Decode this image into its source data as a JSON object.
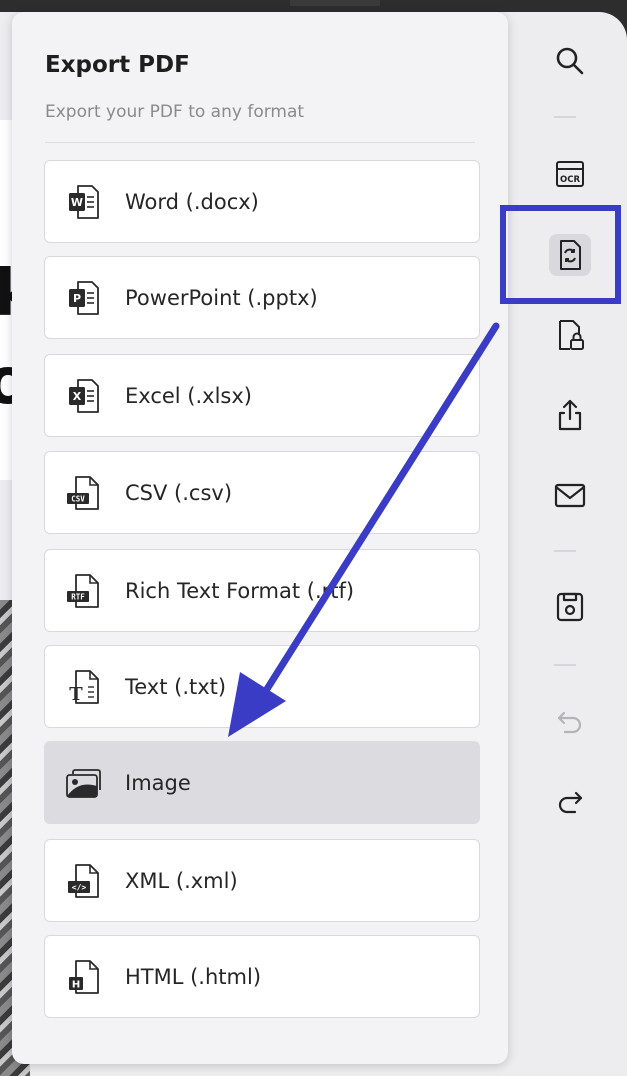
{
  "panel": {
    "title": "Export PDF",
    "subtitle": "Export your PDF to any format",
    "selected_index": 6
  },
  "formats": [
    {
      "label": "Word (.docx)",
      "icon": "word-file-icon",
      "glyph": "W"
    },
    {
      "label": "PowerPoint (.pptx)",
      "icon": "powerpoint-file-icon",
      "glyph": "P"
    },
    {
      "label": "Excel (.xlsx)",
      "icon": "excel-file-icon",
      "glyph": "X"
    },
    {
      "label": "CSV (.csv)",
      "icon": "csv-file-icon",
      "glyph": "CSV"
    },
    {
      "label": "Rich Text Format (.rtf)",
      "icon": "rtf-file-icon",
      "glyph": "RTF"
    },
    {
      "label": "Text (.txt)",
      "icon": "text-file-icon",
      "glyph": "T"
    },
    {
      "label": "Image",
      "icon": "image-file-icon",
      "glyph": ""
    },
    {
      "label": "XML (.xml)",
      "icon": "xml-file-icon",
      "glyph": "</>"
    },
    {
      "label": "HTML (.html)",
      "icon": "html-file-icon",
      "glyph": "H"
    }
  ],
  "toolbar": {
    "items": [
      {
        "name": "search-icon"
      },
      {
        "name": "ocr-icon",
        "text": "OCR"
      },
      {
        "name": "convert-pdf-icon",
        "active": true
      },
      {
        "name": "protect-pdf-icon"
      },
      {
        "name": "share-icon"
      },
      {
        "name": "email-icon"
      },
      {
        "name": "save-icon"
      },
      {
        "name": "undo-icon"
      },
      {
        "name": "redo-icon"
      }
    ]
  },
  "colors": {
    "annotation": "#3b3cc6",
    "selected_row": "#dcdce0",
    "panel_bg": "#f3f3f5"
  }
}
